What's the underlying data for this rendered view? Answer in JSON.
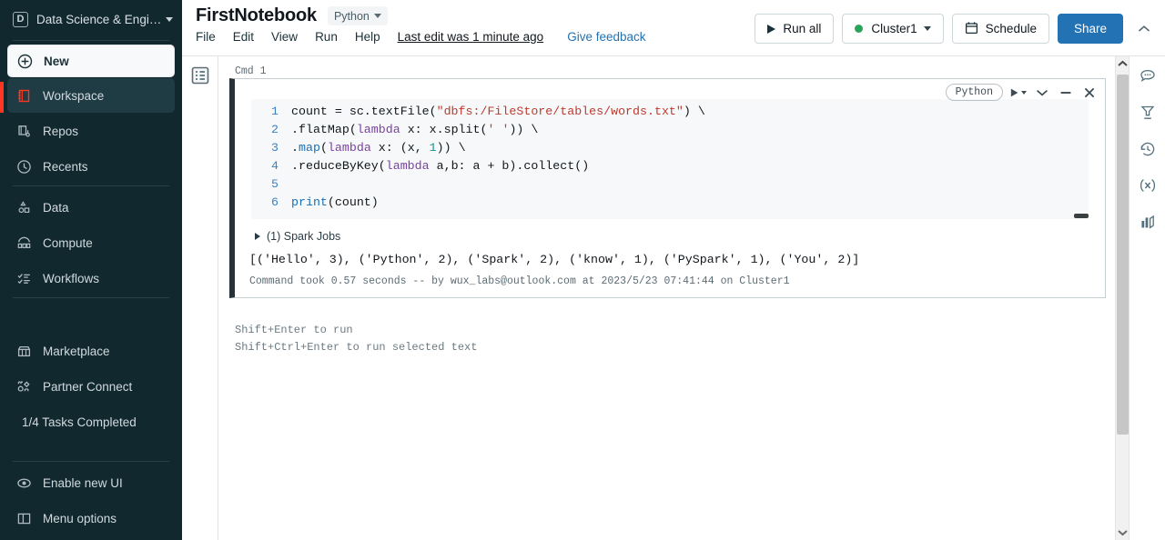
{
  "sidebar": {
    "workspace_name": "Data Science & Engi…",
    "workspace_badge": "D",
    "nav_primary": [
      {
        "label": "New",
        "icon": "plus-circle-icon"
      },
      {
        "label": "Workspace",
        "icon": "workspace-icon"
      },
      {
        "label": "Repos",
        "icon": "repos-icon"
      },
      {
        "label": "Recents",
        "icon": "clock-icon"
      }
    ],
    "nav_secondary": [
      {
        "label": "Data",
        "icon": "data-icon"
      },
      {
        "label": "Compute",
        "icon": "compute-icon"
      },
      {
        "label": "Workflows",
        "icon": "workflows-icon"
      }
    ],
    "nav_tertiary": [
      {
        "label": "Marketplace",
        "icon": "marketplace-icon"
      },
      {
        "label": "Partner Connect",
        "icon": "partner-connect-icon"
      }
    ],
    "tasks_completed": "1/4 Tasks Completed",
    "nav_bottom": [
      {
        "label": "Enable new UI",
        "icon": "eye-toggle-icon"
      },
      {
        "label": "Menu options",
        "icon": "panel-layout-icon"
      }
    ],
    "accent_color": "#ff3621",
    "background_color": "#12282f"
  },
  "header": {
    "notebook_title": "FirstNotebook",
    "language_pill": "Python",
    "menus": [
      "File",
      "Edit",
      "View",
      "Run",
      "Help"
    ],
    "last_edit": "Last edit was 1 minute ago",
    "feedback": "Give feedback",
    "run_all": "Run all",
    "cluster": "Cluster1",
    "cluster_status_color": "#2aa45a",
    "schedule": "Schedule",
    "share": "Share",
    "share_color": "#2272b4"
  },
  "cell": {
    "cmd_label": "Cmd 1",
    "language": "Python",
    "toolbar_icons": [
      "run-cell-icon",
      "chevron-down-icon",
      "minimize-cell-icon",
      "delete-cell-icon"
    ],
    "code_lines": [
      {
        "num": "1",
        "tokens": [
          {
            "t": "count = sc.textFile(",
            "c": "plain"
          },
          {
            "t": "\"dbfs:/FileStore/tables/words.txt\"",
            "c": "str"
          },
          {
            "t": ") \\",
            "c": "plain"
          }
        ]
      },
      {
        "num": "2",
        "tokens": [
          {
            "t": ".flatMap(",
            "c": "plain"
          },
          {
            "t": "lambda",
            "c": "kw"
          },
          {
            "t": " x: x.split(",
            "c": "plain"
          },
          {
            "t": "' '",
            "c": "str"
          },
          {
            "t": ")) \\",
            "c": "plain"
          }
        ]
      },
      {
        "num": "3",
        "tokens": [
          {
            "t": ".",
            "c": "plain"
          },
          {
            "t": "map",
            "c": "fn"
          },
          {
            "t": "(",
            "c": "plain"
          },
          {
            "t": "lambda",
            "c": "kw"
          },
          {
            "t": " x: (x, ",
            "c": "plain"
          },
          {
            "t": "1",
            "c": "num"
          },
          {
            "t": ")) \\",
            "c": "plain"
          }
        ]
      },
      {
        "num": "4",
        "tokens": [
          {
            "t": ".reduceByKey(",
            "c": "plain"
          },
          {
            "t": "lambda",
            "c": "kw"
          },
          {
            "t": " a,b: a + b).collect()",
            "c": "plain"
          }
        ]
      },
      {
        "num": "5",
        "tokens": []
      },
      {
        "num": "6",
        "tokens": [
          {
            "t": "print",
            "c": "fn"
          },
          {
            "t": "(count)",
            "c": "plain"
          }
        ]
      }
    ],
    "spark_jobs": "(1) Spark Jobs",
    "output": "[('Hello', 3), ('Python', 2), ('Spark', 2), ('know', 1), ('PySpark', 1), ('You', 2)]",
    "footer": "Command took 0.57 seconds -- by wux_labs@outlook.com at 2023/5/23 07:41:44 on Cluster1"
  },
  "hints": {
    "line1": "Shift+Enter to run",
    "line2": "Shift+Ctrl+Enter to run selected text"
  },
  "rails": {
    "left_icon": "table-of-contents-icon",
    "right_icons": [
      "comments-icon",
      "filter-icon",
      "revision-history-icon",
      "variable-explorer-icon",
      "data-profile-icon"
    ]
  }
}
